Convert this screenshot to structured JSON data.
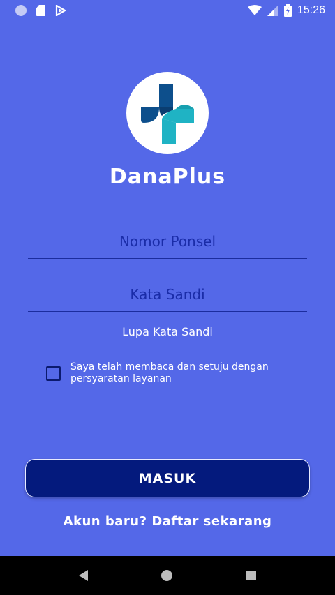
{
  "status_bar": {
    "time": "15:26"
  },
  "app": {
    "name": "DanaPlus"
  },
  "form": {
    "phone_placeholder": "Nomor Ponsel",
    "password_placeholder": "Kata Sandi",
    "forgot_password": "Lupa Kata Sandi",
    "terms_text": "Saya telah membaca dan setuju dengan persyaratan layanan",
    "terms_checked": false,
    "login_label": "MASUK"
  },
  "footer": {
    "register_prompt": "Akun baru?",
    "register_link": "Daftar sekarang"
  },
  "colors": {
    "background": "#5468E8",
    "button": "#041a7d",
    "field_text": "#1a2ca8",
    "logo_dark": "#0d4f8c",
    "logo_teal": "#1fb3c4"
  },
  "icons": {
    "status": [
      "notification-dot-icon",
      "sd-card-icon",
      "app-notification-icon",
      "wifi-icon",
      "signal-icon",
      "battery-icon"
    ],
    "nav": [
      "back-icon",
      "home-icon",
      "recents-icon"
    ]
  }
}
